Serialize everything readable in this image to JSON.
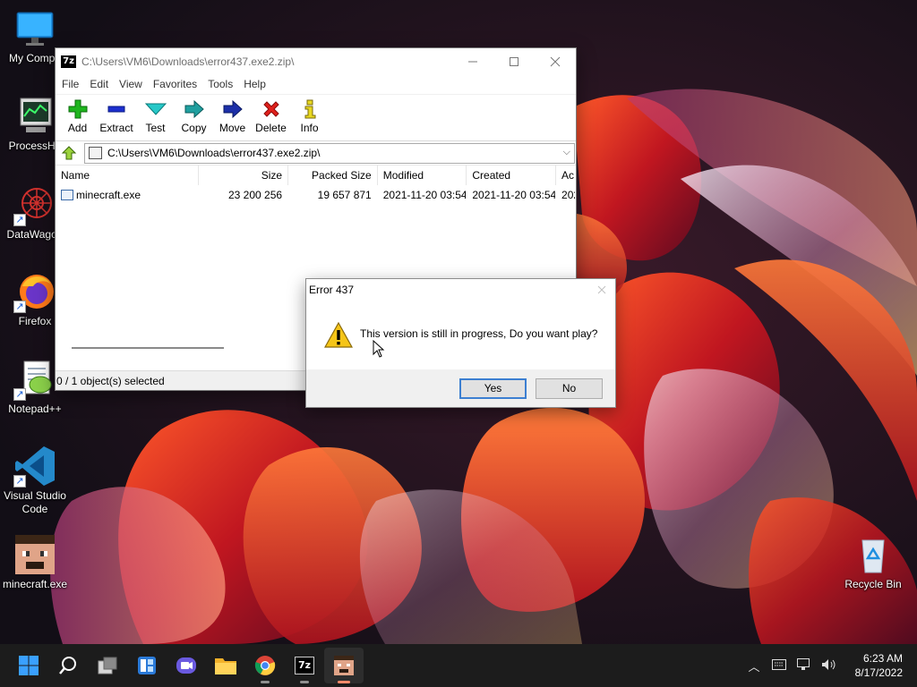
{
  "desktop": {
    "icons": [
      {
        "label": "My Compu",
        "icon": "monitor-icon"
      },
      {
        "label": "ProcessHa",
        "icon": "process-hacker-icon"
      },
      {
        "label": "DataWagon",
        "icon": "datawagon-icon"
      },
      {
        "label": "Firefox",
        "icon": "firefox-icon"
      },
      {
        "label": "Notepad++",
        "icon": "notepadpp-icon"
      },
      {
        "label": "Visual Studio Code",
        "icon": "vscode-icon"
      },
      {
        "label": "minecraft.exe",
        "icon": "minecraft-icon"
      },
      {
        "label": "Recycle Bin",
        "icon": "recycle-bin-icon"
      }
    ]
  },
  "zip_window": {
    "title": "C:\\Users\\VM6\\Downloads\\error437.exe2.zip\\",
    "logo": "7z",
    "menu": [
      "File",
      "Edit",
      "View",
      "Favorites",
      "Tools",
      "Help"
    ],
    "toolbar": [
      {
        "label": "Add",
        "icon": "plus-icon"
      },
      {
        "label": "Extract",
        "icon": "minus-icon"
      },
      {
        "label": "Test",
        "icon": "check-icon"
      },
      {
        "label": "Copy",
        "icon": "arrow-right-icon"
      },
      {
        "label": "Move",
        "icon": "arrow-right-icon"
      },
      {
        "label": "Delete",
        "icon": "x-icon"
      },
      {
        "label": "Info",
        "icon": "info-icon"
      }
    ],
    "address": "C:\\Users\\VM6\\Downloads\\error437.exe2.zip\\",
    "columns": [
      "Name",
      "Size",
      "Packed Size",
      "Modified",
      "Created",
      "Ac"
    ],
    "rows": [
      {
        "name": "minecraft.exe",
        "size": "23 200 256",
        "packed": "19 657 871",
        "modified": "2021-11-20 03:54",
        "created": "2021-11-20 03:54",
        "accessed": "202"
      }
    ],
    "status": "0 / 1 object(s) selected"
  },
  "dialog": {
    "title": "Error 437",
    "message": "This version is still in progress, Do you want play?",
    "yes": "Yes",
    "no": "No"
  },
  "taskbar": {
    "apps": [
      "start-icon",
      "search-icon",
      "task-view-icon",
      "widgets-icon",
      "chat-icon",
      "file-explorer-icon",
      "chrome-icon",
      "7zip-icon",
      "minecraft-icon"
    ],
    "logo_7z": "7z",
    "time": "6:23 AM",
    "date": "8/17/2022"
  },
  "colors": {
    "accent": "#3c7fd1",
    "taskbar": "#1c1c1c"
  }
}
